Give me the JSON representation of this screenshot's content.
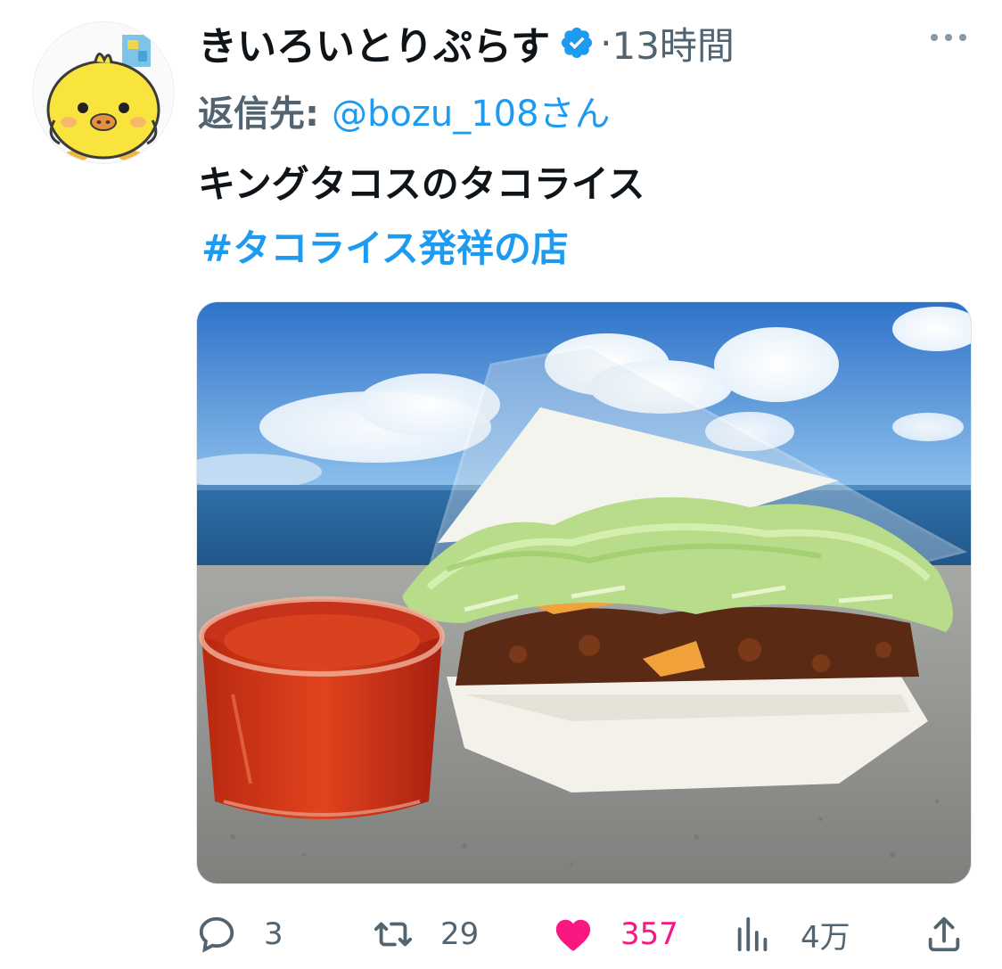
{
  "tweet": {
    "display_name": "きいろいとりぷらす",
    "verified": true,
    "separator": "·",
    "timestamp": "13時間",
    "reply_prefix": "返信先:",
    "reply_handle": "@bozu_108さん",
    "text": "キングタコスのタコライス",
    "hashtag": "#タコライス発祥の店"
  },
  "actions": {
    "reply_count": "3",
    "retweet_count": "29",
    "like_count": "357",
    "views_count": "4万"
  },
  "icons": {
    "more": "more-horizontal-icon",
    "verified": "verified-badge-icon",
    "reply": "speech-bubble-icon",
    "retweet": "retweet-arrows-icon",
    "like": "heart-icon",
    "views": "bar-chart-icon",
    "share": "share-upload-icon"
  },
  "colors": {
    "link": "#1d9bf0",
    "muted": "#536471",
    "like": "#f91880",
    "text": "#0f1419"
  }
}
